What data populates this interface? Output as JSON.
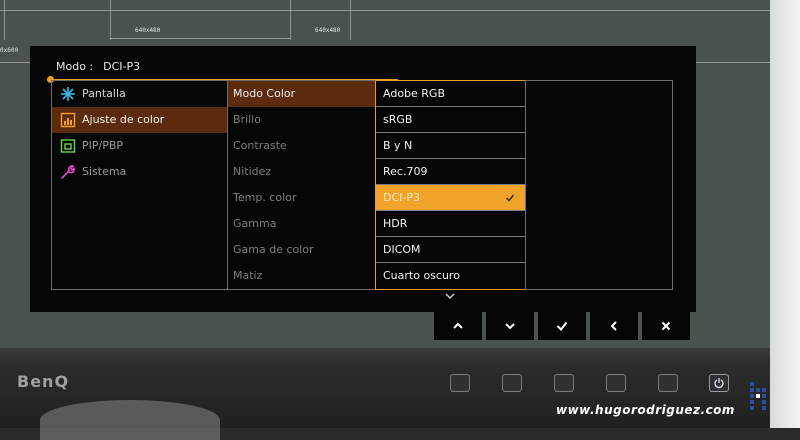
{
  "osd": {
    "mode_label": "Modo :",
    "mode_value": "DCI-P3",
    "menu": [
      {
        "label": "Pantalla",
        "icon": "display-icon",
        "selected": false
      },
      {
        "label": "Ajuste de color",
        "icon": "color-adjust-icon",
        "selected": true
      },
      {
        "label": "PIP/PBP",
        "icon": "pip-icon",
        "selected": false
      },
      {
        "label": "Sistema",
        "icon": "wrench-icon",
        "selected": false
      }
    ],
    "submenu": [
      {
        "label": "Modo Color",
        "selected": true
      },
      {
        "label": "Brillo"
      },
      {
        "label": "Contraste"
      },
      {
        "label": "Nitidez"
      },
      {
        "label": "Temp. color"
      },
      {
        "label": "Gamma"
      },
      {
        "label": "Gama de color"
      },
      {
        "label": "Matiz"
      }
    ],
    "options": [
      {
        "label": "Adobe RGB"
      },
      {
        "label": "sRGB"
      },
      {
        "label": "B y N"
      },
      {
        "label": "Rec.709"
      },
      {
        "label": "DCI-P3",
        "selected": true
      },
      {
        "label": "HDR"
      },
      {
        "label": "DICOM"
      },
      {
        "label": "Cuarto oscuro"
      }
    ],
    "hint_icons": [
      "up-arrow-icon",
      "down-arrow-icon",
      "check-icon",
      "back-arrow-icon",
      "close-icon"
    ]
  },
  "screen": {
    "resolution_labels": [
      "640x480",
      "640x480",
      "0x600"
    ]
  },
  "monitor": {
    "brand": "BenQ"
  },
  "watermark": "www.hugorodriguez.com",
  "colors": {
    "accent": "#e79d25",
    "selected_option": "#f2a42a",
    "selected_row": "#5b2a0f"
  }
}
